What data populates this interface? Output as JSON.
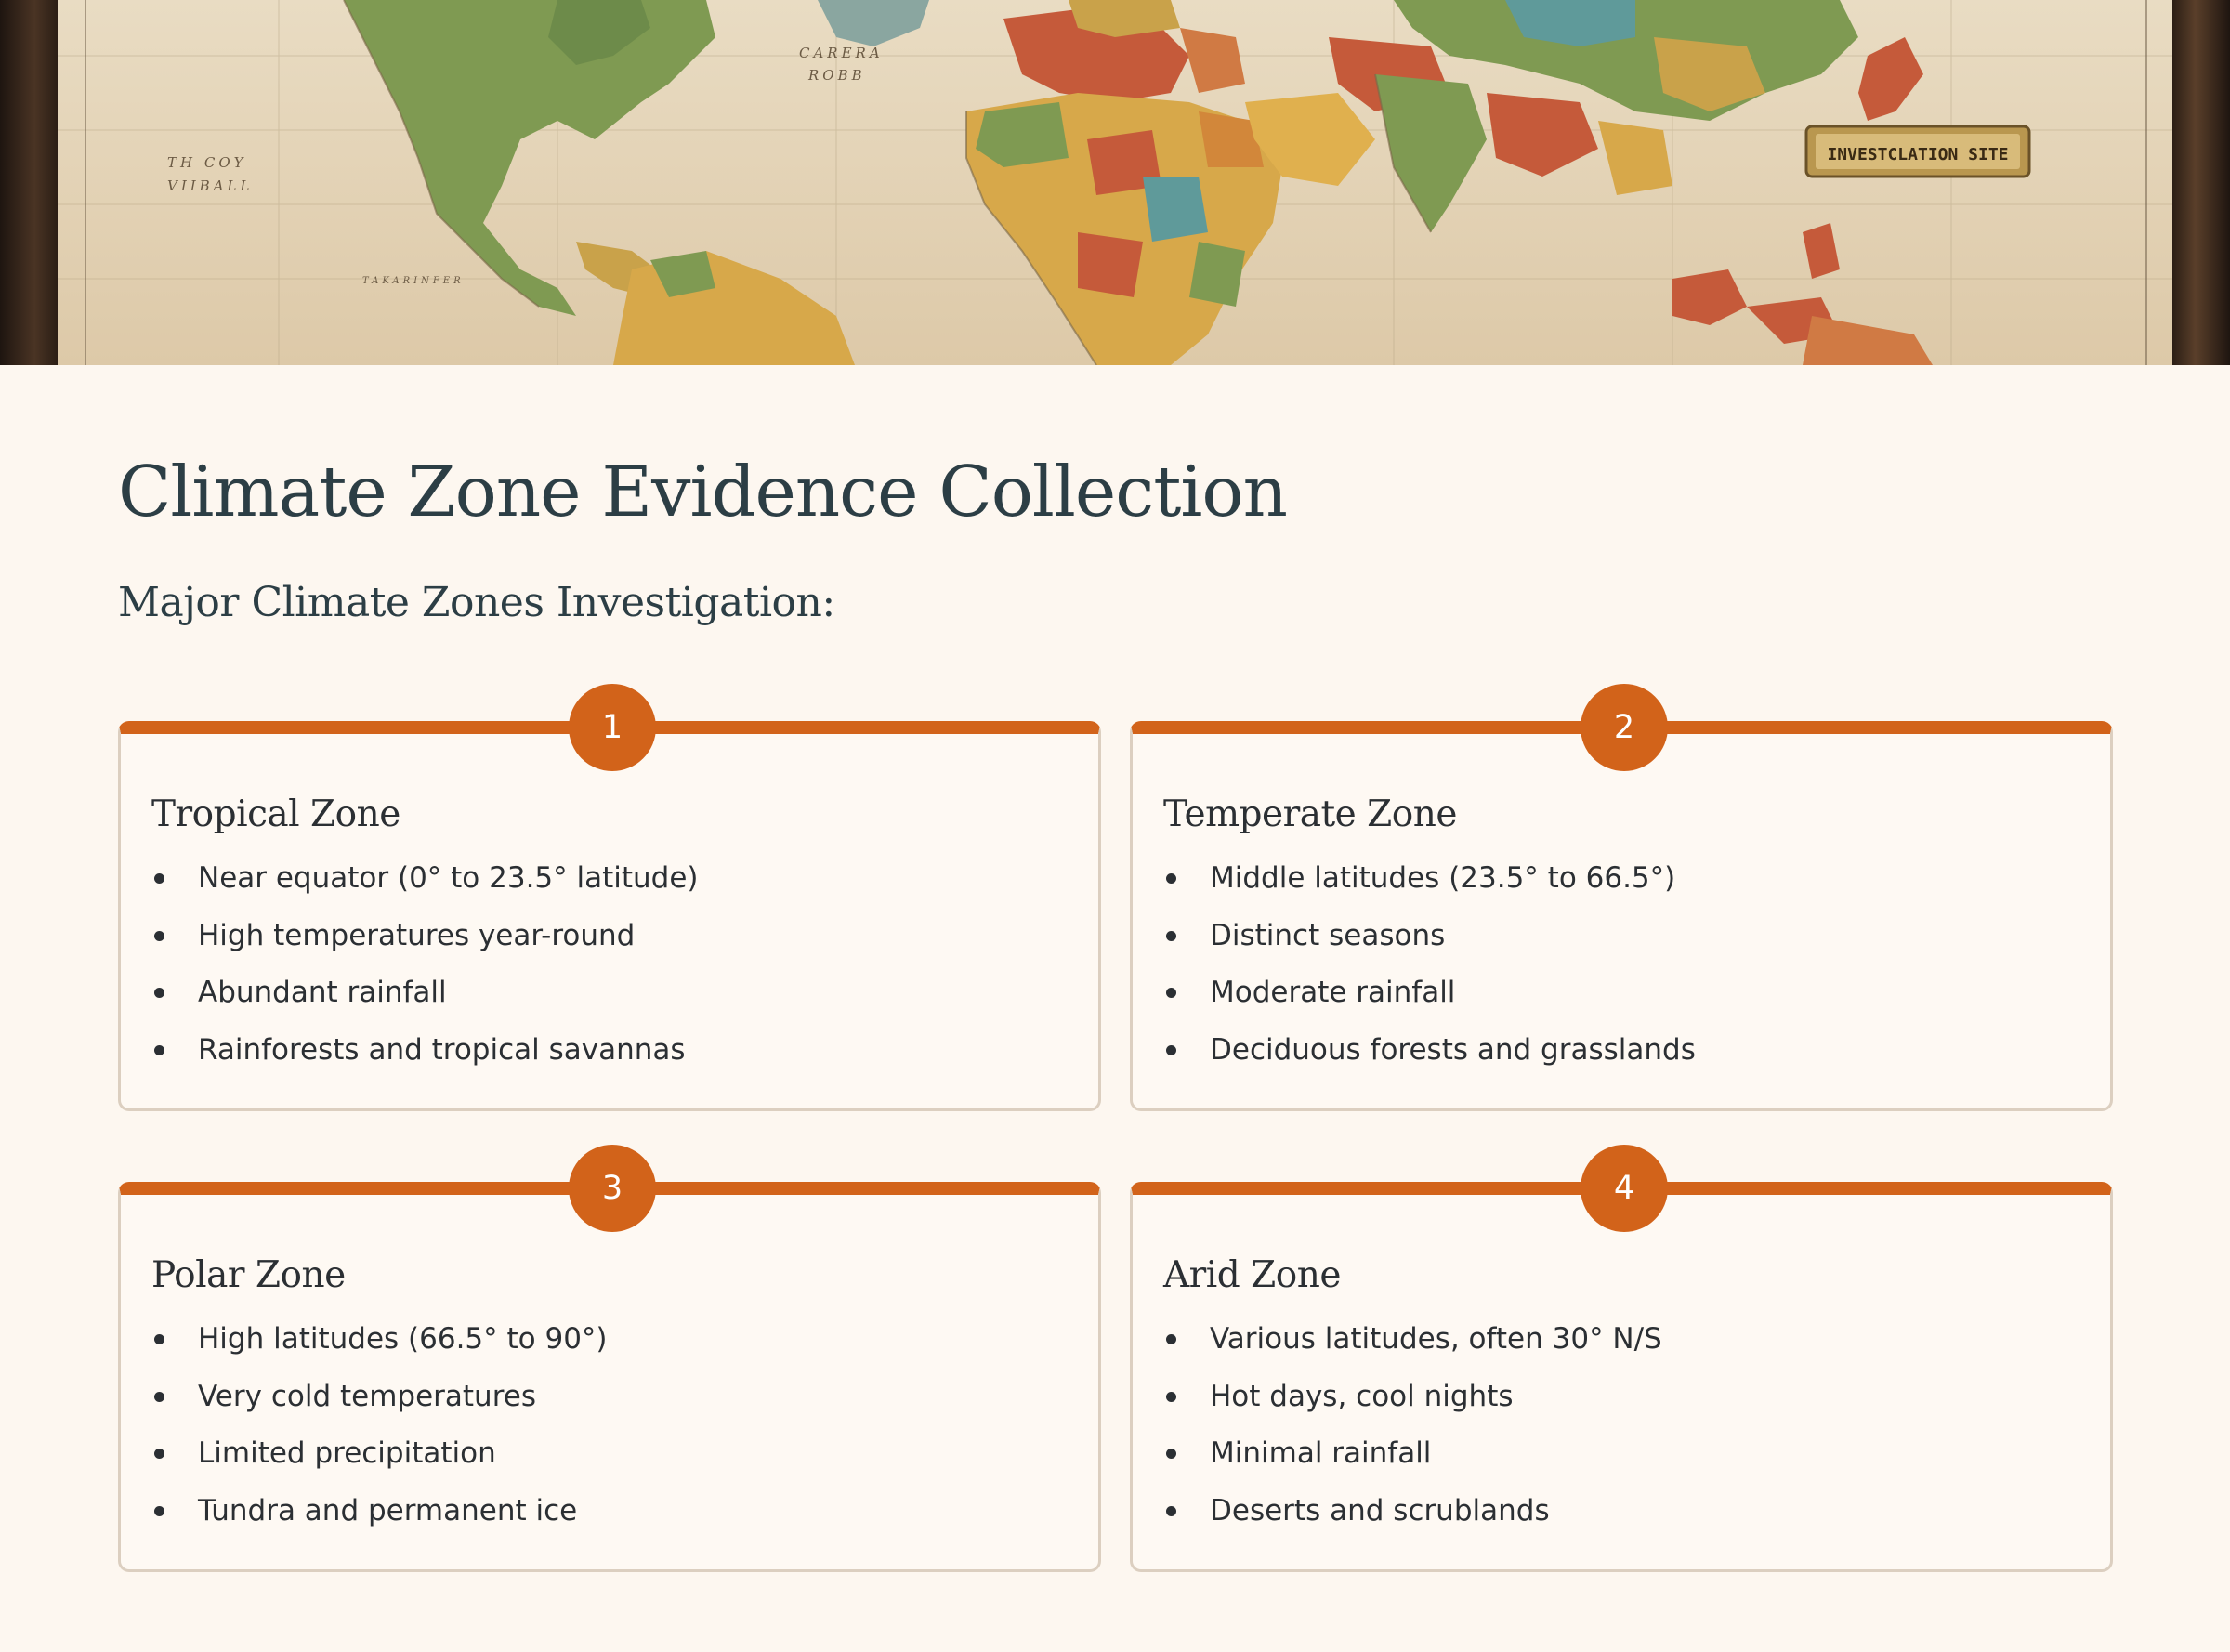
{
  "hero": {
    "image_description_icon": "vintage-world-map",
    "map_labels": [
      "CARERA",
      "ROBB",
      "TH COY",
      "VIIBALL",
      "TAKARINFER"
    ],
    "plaque_text": "INVESTCLATION SITE"
  },
  "page": {
    "title": "Climate Zone Evidence Collection",
    "subtitle": "Major Climate Zones Investigation:"
  },
  "colors": {
    "accent": "#d2631a",
    "background": "#fdf7f0",
    "card_border": "#dccfc0",
    "heading": "#2c3e45"
  },
  "zones": [
    {
      "number": "1",
      "title": "Tropical Zone",
      "points": [
        "Near equator (0° to 23.5° latitude)",
        "High temperatures year-round",
        "Abundant rainfall",
        "Rainforests and tropical savannas"
      ]
    },
    {
      "number": "2",
      "title": "Temperate Zone",
      "points": [
        "Middle latitudes (23.5° to 66.5°)",
        "Distinct seasons",
        "Moderate rainfall",
        "Deciduous forests and grasslands"
      ]
    },
    {
      "number": "3",
      "title": "Polar Zone",
      "points": [
        "High latitudes (66.5° to 90°)",
        "Very cold temperatures",
        "Limited precipitation",
        "Tundra and permanent ice"
      ]
    },
    {
      "number": "4",
      "title": "Arid Zone",
      "points": [
        "Various latitudes, often 30° N/S",
        "Hot days, cool nights",
        "Minimal rainfall",
        "Deserts and scrublands"
      ]
    }
  ]
}
